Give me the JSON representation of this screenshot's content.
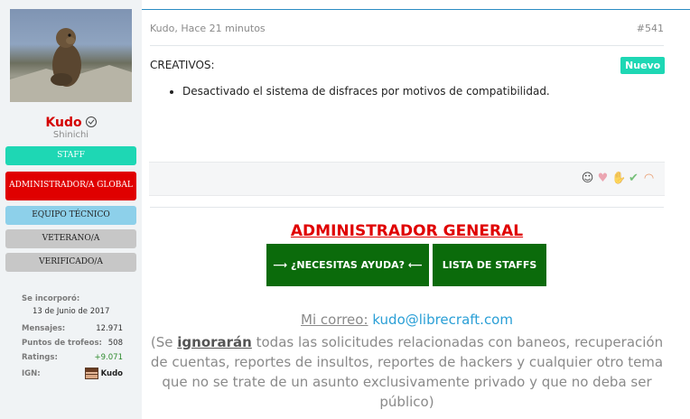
{
  "sidebar": {
    "username": "Kudo",
    "user_title": "Shinichi",
    "banners": {
      "staff": "STAFF",
      "admin": "ADMINISTRADOR/A GLOBAL",
      "tech": "EQUIPO TÉCNICO",
      "veteran": "VETERANO/A",
      "verified": "VERIFICADO/A"
    },
    "stats": {
      "joined_label": "Se incorporó:",
      "joined_value": "13 de Junio de 2017",
      "messages_label": "Mensajes:",
      "messages_value": "12.971",
      "trophies_label": "Puntos de trofeos:",
      "trophies_value": "508",
      "ratings_label": "Ratings:",
      "ratings_value": "+9.071",
      "ign_label": "IGN:",
      "ign_value": "Kudo"
    }
  },
  "post": {
    "meta": "Kudo, Hace 21 minutos",
    "number": "#541",
    "section": "CREATIVOS:",
    "badge": "Nuevo",
    "changes": [
      "Desactivado el sistema de disfraces por motivos de compatibilidad."
    ],
    "reactions": [
      "smile-icon",
      "heart-icon",
      "thumbs-up-icon",
      "check-icon",
      "rainbow-icon"
    ]
  },
  "signature": {
    "title": "ADMINISTRADOR GENERAL",
    "help_button": "⟶ ¿NECESITAS AYUDA? ⟵",
    "staff_button": "LISTA DE STAFFS",
    "mail_label": "Mi correo:",
    "mail_address": "kudo@librecraft.com",
    "notice_open": "(Se ",
    "notice_bold": "ignorarán",
    "notice_rest": " todas las solicitudes relacionadas con baneos, recuperación de cuentas, reportes de insultos, reportes de hackers y cualquier otro tema que no se trate de un asunto exclusivamente privado y que no deba ser público)"
  },
  "colors": {
    "accent_teal": "#1ed7b4",
    "admin_red": "#e00000",
    "button_green": "#0b6b0b",
    "link_blue": "#2a9fd6"
  }
}
